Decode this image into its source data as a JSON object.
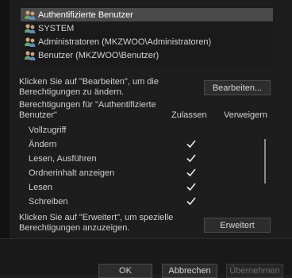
{
  "users": [
    {
      "label": "Authentifizierte Benutzer",
      "icon": "user-group-icon",
      "selected": true
    },
    {
      "label": "SYSTEM",
      "icon": "user-group-icon",
      "selected": false
    },
    {
      "label": "Administratoren (MKZWOO\\Administratoren)",
      "icon": "user-group-icon",
      "selected": false
    },
    {
      "label": "Benutzer (MKZWOO\\Benutzer)",
      "icon": "user-group-icon",
      "selected": false
    }
  ],
  "edit_hint": "Klicken Sie auf \"Bearbeiten\", um die Berechtigungen zu ändern.",
  "edit_hint_line1": "Klicken Sie auf \"Bearbeiten\", um die",
  "edit_hint_line2": "Berechtigungen zu ändern.",
  "edit_button": "Bearbeiten...",
  "perm_header_line1": "Berechtigungen für \"Authentifizierte",
  "perm_header_line2": "Benutzer\"",
  "col_allow": "Zulassen",
  "col_deny": "Verweigern",
  "permissions": [
    {
      "name": "Vollzugriff",
      "allow": false,
      "deny": false
    },
    {
      "name": "Ändern",
      "allow": true,
      "deny": false
    },
    {
      "name": "Lesen, Ausführen",
      "allow": true,
      "deny": false
    },
    {
      "name": "Ordnerinhalt anzeigen",
      "allow": true,
      "deny": false
    },
    {
      "name": "Lesen",
      "allow": true,
      "deny": false
    },
    {
      "name": "Schreiben",
      "allow": true,
      "deny": false
    }
  ],
  "advanced_hint_line1": "Klicken Sie auf \"Erweitert\", um spezielle",
  "advanced_hint_line2": "Berechtigungen anzuzeigen.",
  "advanced_button": "Erweitert",
  "ok_button": "OK",
  "cancel_button": "Abbrechen",
  "apply_button": "Übernehmen",
  "colors": {
    "background": "#1d1d1d",
    "selection": "#4a4a4a",
    "text": "#cfcfcf",
    "check": "#e8e8e8"
  }
}
